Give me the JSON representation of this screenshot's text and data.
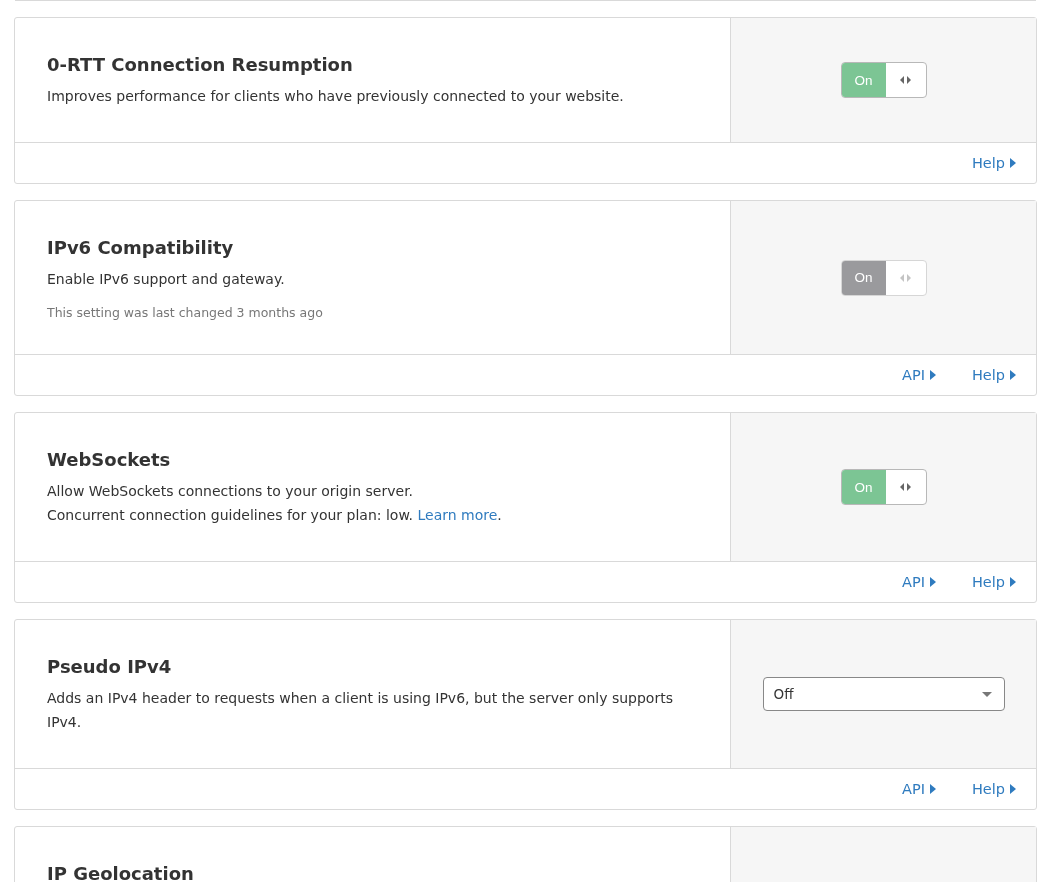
{
  "settings": [
    {
      "kind": "toggle",
      "title": "0-RTT Connection Resumption",
      "description": [
        {
          "text": "Improves performance for clients who have previously connected to your website."
        }
      ],
      "toggle": {
        "label": "On",
        "on": true,
        "disabled": false
      },
      "links": [
        "Help"
      ]
    },
    {
      "kind": "toggle",
      "title": "IPv6 Compatibility",
      "description": [
        {
          "text": "Enable IPv6 support and gateway."
        }
      ],
      "note": "This setting was last changed 3 months ago",
      "toggle": {
        "label": "On",
        "on": true,
        "disabled": true
      },
      "links": [
        "API",
        "Help"
      ]
    },
    {
      "kind": "toggle",
      "title": "WebSockets",
      "description": [
        {
          "text": "Allow WebSockets connections to your origin server."
        },
        {
          "text": "Concurrent connection guidelines for your plan: low.",
          "link": "Learn more",
          "after": "."
        }
      ],
      "toggle": {
        "label": "On",
        "on": true,
        "disabled": false
      },
      "links": [
        "API",
        "Help"
      ]
    },
    {
      "kind": "select",
      "title": "Pseudo IPv4",
      "description": [
        {
          "text": "Adds an IPv4 header to requests when a client is using IPv6, but the server only supports IPv4."
        }
      ],
      "select": {
        "value": "Off"
      },
      "links": [
        "API",
        "Help"
      ]
    },
    {
      "kind": "empty",
      "title": "IP Geolocation"
    }
  ]
}
